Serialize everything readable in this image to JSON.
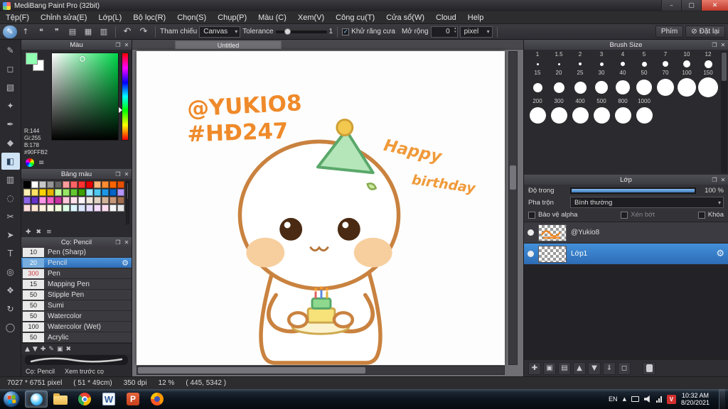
{
  "window": {
    "title": "MediBang Paint Pro (32bit)"
  },
  "menu": {
    "items": [
      "Tệp(F)",
      "Chỉnh sửa(E)",
      "Lớp(L)",
      "Bộ lọc(R)",
      "Chọn(S)",
      "Chụp(P)",
      "Màu (C)",
      "Xem(V)",
      "Công cụ(T)",
      "Cửa sổ(W)",
      "Cloud",
      "Help"
    ]
  },
  "toolbar": {
    "icons": [
      {
        "name": "brush-mode-icon",
        "glyph": "✎",
        "selected": true
      },
      {
        "name": "upload-icon",
        "glyph": "↑"
      },
      {
        "name": "comment-icon",
        "glyph": "❝"
      },
      {
        "name": "chat-icon",
        "glyph": "❞"
      },
      {
        "name": "note-icon",
        "glyph": "▤"
      },
      {
        "name": "grid-icon",
        "glyph": "▦"
      },
      {
        "name": "material-icon",
        "glyph": "▥"
      }
    ],
    "undo_icon": "↶",
    "redo_icon": "↷",
    "ref_label": "Tham chiếu",
    "ref_value": "Canvas",
    "tolerance_label": "Tolerance",
    "tolerance_value": "1",
    "antialias_label": "Khử răng cưa",
    "expand_label": "Mở rộng",
    "expand_value": "0",
    "expand_unit": "pixel",
    "key_button": "Phím",
    "reset_icon": "⊘",
    "reset_button": "Đặt lại"
  },
  "tools": [
    {
      "name": "pen-tool",
      "glyph": "✎"
    },
    {
      "name": "eraser-tool",
      "glyph": "◻"
    },
    {
      "name": "marquee-select-tool",
      "glyph": "▧"
    },
    {
      "name": "autoselect-tool",
      "glyph": "✦"
    },
    {
      "name": "pen-nib-tool",
      "glyph": "✒"
    },
    {
      "name": "fill-tool",
      "glyph": "◆"
    },
    {
      "name": "bucket-tool",
      "glyph": "◧",
      "selected": true
    },
    {
      "name": "gradient-tool",
      "glyph": "▥"
    },
    {
      "name": "select-pen-tool",
      "glyph": "◌"
    },
    {
      "name": "lasso-tool",
      "glyph": "✂"
    },
    {
      "name": "operation-tool",
      "glyph": "➤"
    },
    {
      "name": "text-tool",
      "glyph": "T"
    },
    {
      "name": "eyedropper-tool",
      "glyph": "◎"
    },
    {
      "name": "hand-tool",
      "glyph": "❖"
    },
    {
      "name": "rotate-tool",
      "glyph": "↻"
    },
    {
      "name": "zoom-tool",
      "glyph": "◯"
    }
  ],
  "color_panel": {
    "title": "Màu",
    "r": "R:144",
    "g": "Gi:255",
    "b": "B:178",
    "hex": "#90FFB2",
    "fg_color": "#90FFB2",
    "bg_color": "#ffffff"
  },
  "palette_panel": {
    "title": "Bảng màu",
    "colors": [
      "#000000",
      "#ffffff",
      "#c8c8c8",
      "#969696",
      "#646464",
      "#ff9c9c",
      "#ff6464",
      "#ff3232",
      "#e60000",
      "#ffb478",
      "#ff8c32",
      "#ff6400",
      "#e65000",
      "#fff0b4",
      "#ffe164",
      "#ffd200",
      "#e6b400",
      "#c8ff96",
      "#96e664",
      "#64c832",
      "#3ca000",
      "#96e6ff",
      "#50c8f0",
      "#1e96e6",
      "#0064c8",
      "#b496ff",
      "#8c64e6",
      "#6432c8",
      "#ff96e6",
      "#f064c8",
      "#c832a0",
      "#ffc8dc",
      "#ffe1eb",
      "#fff5fa",
      "#f0e6dc",
      "#e1d2c3",
      "#d2b49b",
      "#c89678",
      "#a06e50",
      "#ffdcdc",
      "#ffe6d2",
      "#fff0dc",
      "#fffae6",
      "#f0ffdc",
      "#dcffe6",
      "#dcf5ff",
      "#dce6ff",
      "#e6dcff",
      "#f5dcff",
      "#ffdcf0",
      "#f5f5f5",
      "#e6e6e6"
    ],
    "footer_icons": [
      {
        "name": "add-color-icon",
        "glyph": "✚"
      },
      {
        "name": "delete-color-icon",
        "glyph": "✖"
      },
      {
        "name": "palette-menu-icon",
        "glyph": "≡"
      }
    ]
  },
  "brush_panel": {
    "title": "Cọ: Pencil",
    "brushes": [
      {
        "size": "10",
        "name": "Pen (Sharp)",
        "selected": false,
        "hot": false
      },
      {
        "size": "20",
        "name": "Pencil",
        "selected": true,
        "hot": false
      },
      {
        "size": "300",
        "name": "Pen",
        "selected": false,
        "hot": true
      },
      {
        "size": "15",
        "name": "Mapping Pen",
        "selected": false,
        "hot": false
      },
      {
        "size": "50",
        "name": "Stipple Pen",
        "selected": false,
        "hot": false
      },
      {
        "size": "50",
        "name": "Sumi",
        "selected": false,
        "hot": false
      },
      {
        "size": "50",
        "name": "Watercolor",
        "selected": false,
        "hot": false
      },
      {
        "size": "100",
        "name": "Watercolor (Wet)",
        "selected": false,
        "hot": false
      },
      {
        "size": "50",
        "name": "Acrylic",
        "selected": false,
        "hot": false
      }
    ],
    "footer_icons": [
      {
        "name": "brush-up-icon",
        "glyph": "▲"
      },
      {
        "name": "brush-down-icon",
        "glyph": "▼"
      },
      {
        "name": "add-brush-icon",
        "glyph": "✚"
      },
      {
        "name": "edit-brush-icon",
        "glyph": "✎"
      },
      {
        "name": "brush-folder-icon",
        "glyph": "▣"
      },
      {
        "name": "delete-brush-icon",
        "glyph": "✖"
      }
    ],
    "current_label": "Cọ: Pencil",
    "preview_label": "Xem trước cọ"
  },
  "canvas": {
    "tab": "Untitled",
    "texts": {
      "handle": "@YUKIO8",
      "tag": "#HĐ247",
      "greet1": "Happy",
      "greet2": "birthday"
    }
  },
  "brush_size_panel": {
    "title": "Brush Size",
    "rows": [
      {
        "h": 16,
        "items": [
          {
            "label": "1",
            "d": 3
          },
          {
            "label": "1.5",
            "d": 3
          },
          {
            "label": "2",
            "d": 4
          },
          {
            "label": "3",
            "d": 5
          },
          {
            "label": "4",
            "d": 6
          },
          {
            "label": "5",
            "d": 7
          },
          {
            "label": "7",
            "d": 8
          },
          {
            "label": "10",
            "d": 10
          },
          {
            "label": "12",
            "d": 11
          }
        ]
      },
      {
        "h": 30,
        "items": [
          {
            "label": "15",
            "d": 13
          },
          {
            "label": "20",
            "d": 15
          },
          {
            "label": "25",
            "d": 17
          },
          {
            "label": "30",
            "d": 18
          },
          {
            "label": "40",
            "d": 20
          },
          {
            "label": "50",
            "d": 22
          },
          {
            "label": "70",
            "d": 24
          },
          {
            "label": "100",
            "d": 26
          },
          {
            "label": "150",
            "d": 28
          }
        ]
      },
      {
        "h": 28,
        "items": [
          {
            "label": "200",
            "d": 23
          },
          {
            "label": "300",
            "d": 23
          },
          {
            "label": "400",
            "d": 23
          },
          {
            "label": "500",
            "d": 23
          },
          {
            "label": "800",
            "d": 23
          },
          {
            "label": "1000",
            "d": 23
          }
        ]
      }
    ]
  },
  "layer_panel": {
    "title": "Lớp",
    "opacity_label": "Độ trong",
    "opacity_value": "100 %",
    "blend_label": "Pha trộn",
    "blend_value": "Bình thường",
    "checks": [
      {
        "label": "Bảo vệ alpha",
        "dim": false
      },
      {
        "label": "Xén bớt",
        "dim": true
      },
      {
        "label": "Khóa",
        "dim": false
      }
    ],
    "layers": [
      {
        "name": "@Yukio8",
        "selected": false,
        "scribble": true
      },
      {
        "name": "Lớp1",
        "selected": true,
        "scribble": false
      }
    ],
    "footer_icons": [
      {
        "name": "new-layer-icon",
        "glyph": "✚"
      },
      {
        "name": "duplicate-layer-icon",
        "glyph": "▣"
      },
      {
        "name": "layer-folder-icon",
        "glyph": "▤"
      },
      {
        "name": "layer-up-icon",
        "glyph": "▲"
      },
      {
        "name": "layer-down-icon",
        "glyph": "▼"
      },
      {
        "name": "merge-layer-icon",
        "glyph": "⇓"
      },
      {
        "name": "clear-layer-icon",
        "glyph": "◻"
      },
      {
        "name": "delete-layer-icon",
        "glyph": "",
        "trash": true
      }
    ]
  },
  "status_bar": {
    "doc_size": "7027 * 6751 pixel",
    "doc_cm": "( 51 * 49cm)",
    "dpi": "350 dpi",
    "zoom": "12 %",
    "coords": "( 445, 5342 )"
  },
  "taskbar": {
    "lang": "EN",
    "time": "10:32 AM",
    "date": "8/20/2021"
  },
  "brand_colors": {
    "selection_blue": "#2e74c0",
    "drawing_orange": "#ef8a2a",
    "outline_brown": "#c9823f"
  }
}
